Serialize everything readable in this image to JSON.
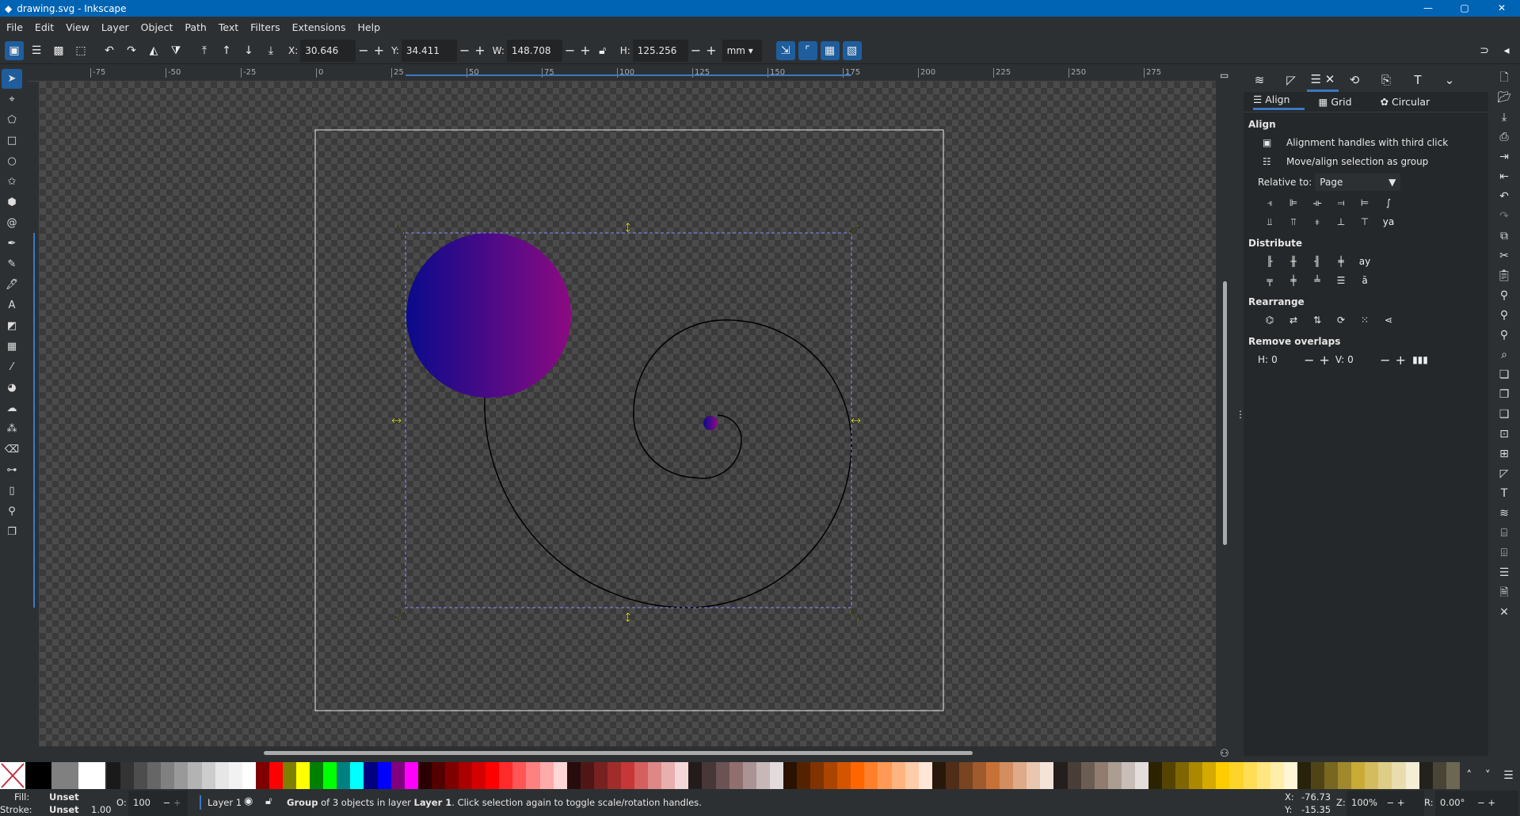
{
  "window": {
    "title": "drawing.svg - Inkscape",
    "minimize": "—",
    "maximize": "▢",
    "close": "✕"
  },
  "menu": [
    "File",
    "Edit",
    "View",
    "Layer",
    "Object",
    "Path",
    "Text",
    "Filters",
    "Extensions",
    "Help"
  ],
  "toolbar": {
    "x_label": "X:",
    "x": "30.646",
    "y_label": "Y:",
    "y": "34.411",
    "w_label": "W:",
    "w": "148.708",
    "h_label": "H:",
    "h": "125.256",
    "unit": "mm",
    "minus": "−",
    "plus": "+"
  },
  "ruler_top_labels": [
    "-75",
    "-50",
    "-25",
    "0",
    "25",
    "50",
    "75",
    "100",
    "125",
    "150",
    "175",
    "200",
    "225",
    "250",
    "275"
  ],
  "dock": {
    "subtabs": [
      "Align",
      "Grid",
      "Circular"
    ],
    "align_heading": "Align",
    "opt1": "Alignment handles with third click",
    "opt2": "Move/align selection as group",
    "relative_label": "Relative to:",
    "relative_value": "Page",
    "distribute_heading": "Distribute",
    "rearrange_heading": "Rearrange",
    "overlaps_heading": "Remove overlaps",
    "h_label": "H:",
    "h_value": "0",
    "v_label": "V:",
    "v_value": "0"
  },
  "colors": {
    "accent": "#0064b4",
    "selection": "#3b78c2",
    "handle": "#ffff33",
    "grad_start": "#0a0a8c",
    "grad_end": "#8c0a82"
  },
  "palette": [
    "#1a1a1a",
    "#333333",
    "#4d4d4d",
    "#666666",
    "#808080",
    "#999999",
    "#b3b3b3",
    "#cccccc",
    "#e6e6e6",
    "#f2f2f2",
    "#ffffff",
    "#800000",
    "#ff0000",
    "#808000",
    "#ffff00",
    "#008000",
    "#00ff00",
    "#008080",
    "#00ffff",
    "#000080",
    "#0000ff",
    "#800080",
    "#ff00ff",
    "#2b0000",
    "#550000",
    "#800000",
    "#aa0000",
    "#d40000",
    "#ff0000",
    "#ff2a2a",
    "#ff5555",
    "#ff8080",
    "#ffaaaa",
    "#ffd5d5",
    "#280b0b",
    "#501616",
    "#782121",
    "#a02c2c",
    "#c83737",
    "#d35f5f",
    "#de8787",
    "#e9afaf",
    "#f4d7d7",
    "#241c1c",
    "#483737",
    "#6c5353",
    "#916f6f",
    "#ac9393",
    "#c8b7b7",
    "#e3dbdb",
    "#2b1100",
    "#552200",
    "#803300",
    "#aa4400",
    "#d45500",
    "#ff6600",
    "#ff7f2a",
    "#ff9955",
    "#ffb380",
    "#ffccaa",
    "#ffe6d5",
    "#28170b",
    "#502d16",
    "#784421",
    "#a05a2c",
    "#c87137",
    "#d38d5f",
    "#deaa87",
    "#e9c6af",
    "#f4e3d7",
    "#241f1c",
    "#483e37",
    "#6c5d53",
    "#917c6f",
    "#ac9d93",
    "#c8beb7",
    "#e3dedb",
    "#2b2200",
    "#554400",
    "#806600",
    "#aa8800",
    "#d4aa00",
    "#ffcc00",
    "#ffd42a",
    "#ffdd55",
    "#ffe680",
    "#ffeeaa",
    "#fff6d5",
    "#28220b",
    "#504416",
    "#786721",
    "#a0892c",
    "#c8ab37",
    "#d3bc5f",
    "#decd87",
    "#e9ddaf",
    "#f4eed7",
    "#24221c",
    "#484537",
    "#6c6753"
  ],
  "status": {
    "fill_label": "Fill:",
    "fill": "Unset",
    "stroke_label": "Stroke:",
    "stroke": "Unset",
    "stroke_width": "1.00",
    "opacity_label": "O:",
    "opacity": "100",
    "layer": "Layer 1",
    "msg_b1": "Group",
    "msg_1": " of 3 objects in layer ",
    "msg_b2": "Layer 1",
    "msg_2": ". Click selection again to toggle scale/rotation handles.",
    "cx_label": "X:",
    "cx": "-76.73",
    "cy_label": "Y:",
    "cy": "-15.35",
    "zoom_label": "Z:",
    "zoom": "100%",
    "rot_label": "R:",
    "rot": "0.00°"
  }
}
